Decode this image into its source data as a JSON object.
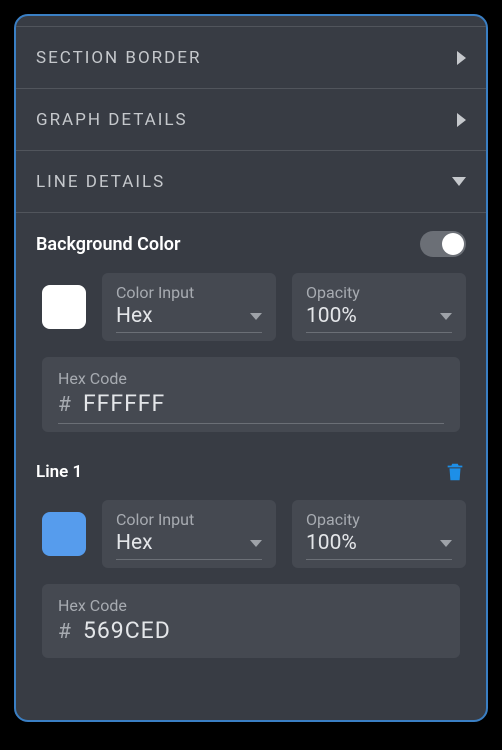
{
  "sections": {
    "border": {
      "label": "SECTION BORDER"
    },
    "graph": {
      "label": "GRAPH DETAILS"
    },
    "line": {
      "label": "LINE DETAILS"
    }
  },
  "background": {
    "label": "Background Color",
    "colorInputLabel": "Color Input",
    "colorInputValue": "Hex",
    "opacityLabel": "Opacity",
    "opacityValue": "100%",
    "hexLabel": "Hex Code",
    "hexPrefix": "#",
    "hexValue": "FFFFFF",
    "swatch": "#FFFFFF"
  },
  "lines": [
    {
      "title": "Line 1",
      "colorInputLabel": "Color Input",
      "colorInputValue": "Hex",
      "opacityLabel": "Opacity",
      "opacityValue": "100%",
      "hexLabel": "Hex Code",
      "hexPrefix": "#",
      "hexValue": "569CED",
      "swatch": "#569CED"
    }
  ]
}
